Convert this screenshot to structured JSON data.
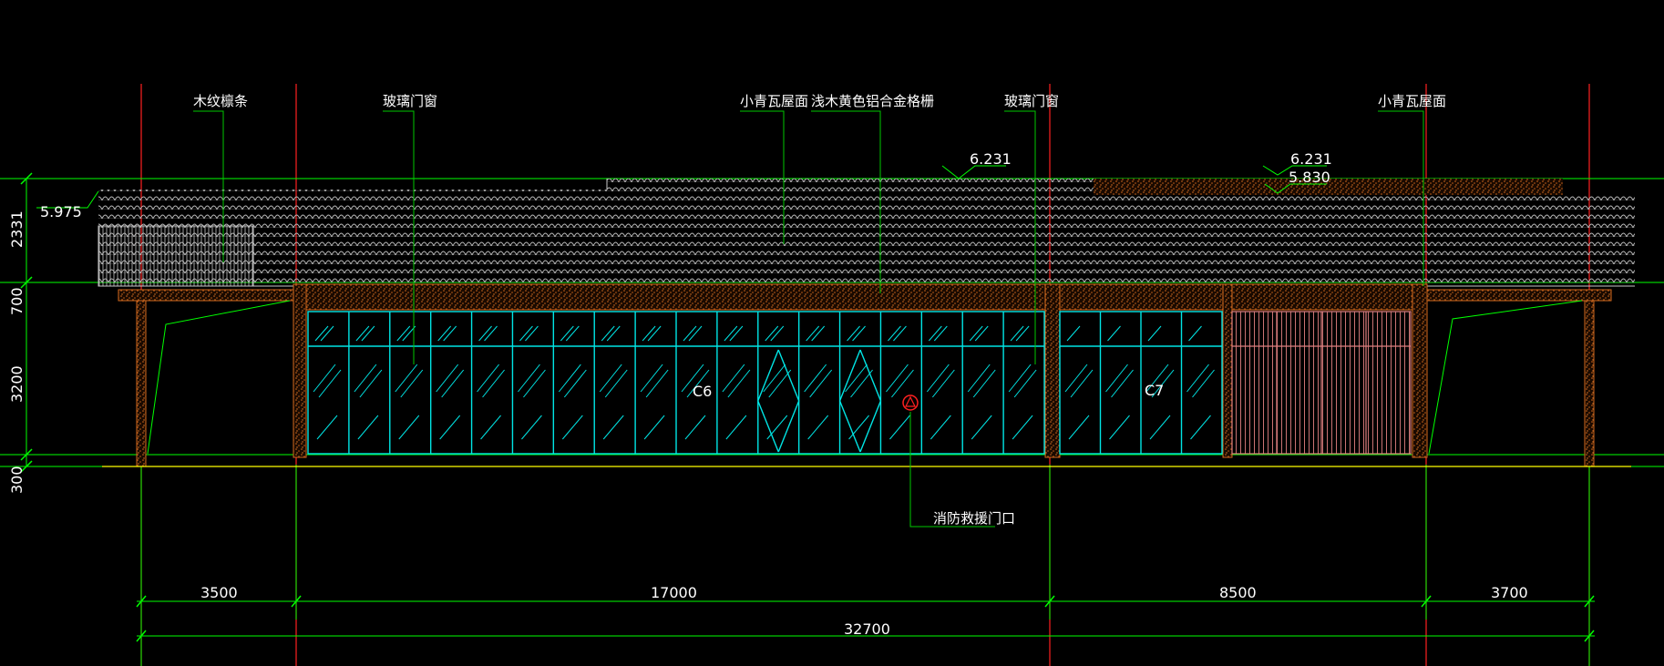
{
  "drawing": {
    "background": "#000000",
    "colors": {
      "axis": "#ff2020",
      "dim": "#00ff00",
      "leader": "#00c800",
      "tile": "#c8c8c8",
      "wood": "#d2691e",
      "glass": "#00e5e5",
      "door": "#ff8080",
      "ground": "#ffff00",
      "symbol": "#ff2020"
    },
    "callouts": [
      "木纹檩条",
      "玻璃门窗",
      "小青瓦屋面",
      "浅木黄色铝合金格栅",
      "玻璃门窗",
      "小青瓦屋面",
      "消防救援门口"
    ],
    "window_tags": [
      "C6",
      "C7"
    ],
    "levels": [
      "5.975",
      "6.231",
      "6.231",
      "5.830"
    ],
    "vertical_dims": [
      "2331",
      "700",
      "3200",
      "300"
    ],
    "horizontal_dims": [
      "3500",
      "17000",
      "8500",
      "3700"
    ],
    "overall_dim": "32700"
  }
}
